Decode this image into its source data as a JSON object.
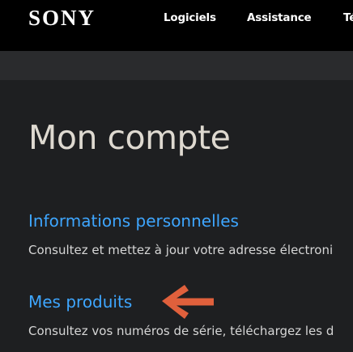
{
  "header": {
    "logo": "SONY",
    "nav": [
      "Logiciels",
      "Assistance",
      "Té"
    ]
  },
  "page": {
    "title": "Mon compte",
    "sections": [
      {
        "link": "Informations personnelles",
        "description": "Consultez et mettez à jour votre adresse électroni"
      },
      {
        "link": "Mes produits",
        "description": "Consultez vos numéros de série, téléchargez les d"
      }
    ]
  },
  "annotation": {
    "arrow_icon": "left-arrow-icon",
    "arrow_color": "#e0603c"
  },
  "colors": {
    "link": "#3ea6ff",
    "title": "#ded9d0",
    "header_bg": "#000000",
    "page_bg": "#1e1f21"
  }
}
